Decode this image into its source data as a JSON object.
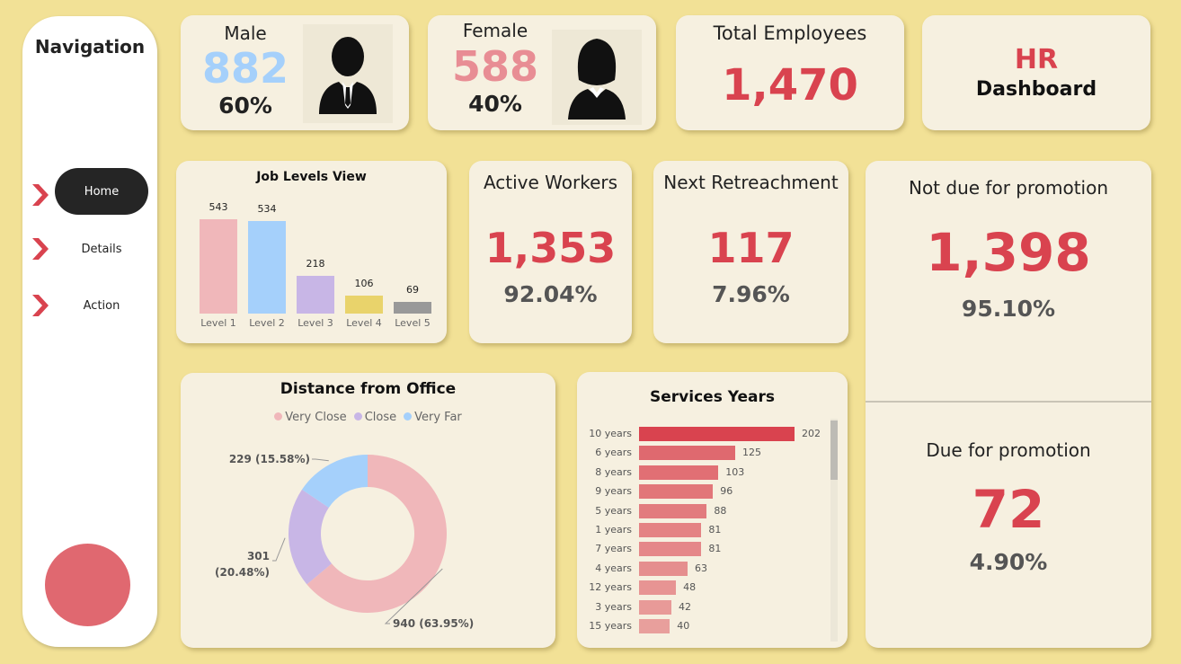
{
  "navigation": {
    "title": "Navigation",
    "items": [
      {
        "label": "Home",
        "active": true
      },
      {
        "label": "Details",
        "active": false
      },
      {
        "label": "Action",
        "active": false
      }
    ]
  },
  "male": {
    "label": "Male",
    "count": "882",
    "percent": "60%"
  },
  "female": {
    "label": "Female",
    "count": "588",
    "percent": "40%"
  },
  "total": {
    "label": "Total Employees",
    "value": "1,470"
  },
  "brand": {
    "line1": "HR",
    "line2": "Dashboard"
  },
  "active_workers": {
    "label": "Active Workers",
    "value": "1,353",
    "percent": "92.04%"
  },
  "next_retreachment": {
    "label": "Next Retreachment",
    "value": "117",
    "percent": "7.96%"
  },
  "not_due": {
    "label": "Not due for promotion",
    "value": "1,398",
    "percent": "95.10%"
  },
  "due": {
    "label": "Due for promotion",
    "value": "72",
    "percent": "4.90%"
  },
  "colors": {
    "accent_red": "#d9434f",
    "male_blue": "#a5d0fb",
    "female_pink": "#e88d94",
    "background": "#f2e196",
    "card": "#f6f0e0"
  },
  "chart_data": [
    {
      "type": "bar",
      "title": "Job Levels View",
      "categories": [
        "Level 1",
        "Level 2",
        "Level 3",
        "Level 4",
        "Level 5"
      ],
      "values": [
        543,
        534,
        218,
        106,
        69
      ],
      "colors": [
        "#f0b7ba",
        "#a5d0fb",
        "#c8b6e6",
        "#e9d36b",
        "#999999"
      ]
    },
    {
      "type": "pie",
      "title": "Distance from Office",
      "legend": [
        "Very Close",
        "Close",
        "Very Far"
      ],
      "values": [
        940,
        301,
        229
      ],
      "labels": [
        "940 (63.95%)",
        "301 (20.48%)",
        "229 (15.58%)"
      ],
      "colors": [
        "#f0b7ba",
        "#c8b6e6",
        "#a5d0fb"
      ],
      "legend_position": "top"
    },
    {
      "type": "bar",
      "orientation": "horizontal",
      "title": "Services Years",
      "categories": [
        "10 years",
        "6 years",
        "8 years",
        "9 years",
        "5 years",
        "1 years",
        "7 years",
        "4 years",
        "12 years",
        "3 years",
        "15 years"
      ],
      "values": [
        202,
        125,
        103,
        96,
        88,
        81,
        81,
        63,
        48,
        42,
        40
      ]
    }
  ]
}
